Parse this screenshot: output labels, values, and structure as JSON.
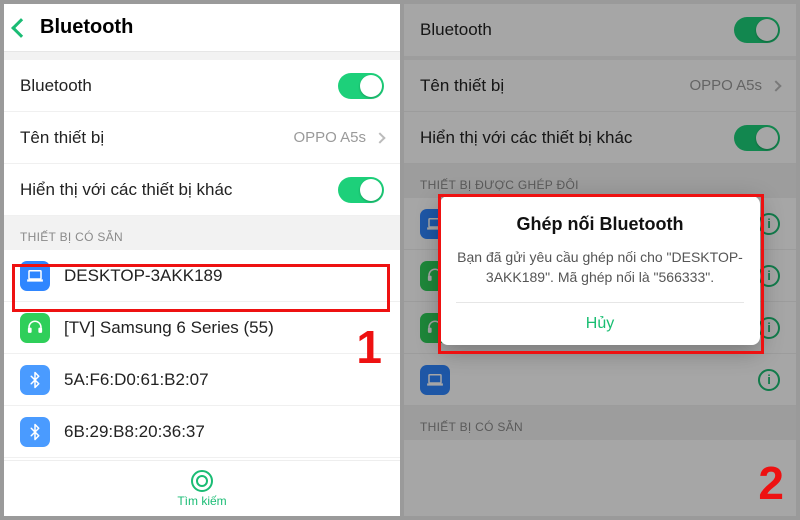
{
  "left": {
    "title": "Bluetooth",
    "rows": {
      "bluetooth": "Bluetooth",
      "device_name_label": "Tên thiết bị",
      "device_name_value": "OPPO A5s",
      "visibility": "Hiển thị với các thiết bị khác"
    },
    "section_available": "THIẾT BỊ CÓ SẴN",
    "devices": [
      {
        "name": "DESKTOP-3AKK189",
        "kind": "laptop"
      },
      {
        "name": "[TV] Samsung 6 Series (55)",
        "kind": "tv"
      },
      {
        "name": "5A:F6:D0:61:B2:07",
        "kind": "bt"
      },
      {
        "name": "6B:29:B8:20:36:37",
        "kind": "bt"
      }
    ],
    "footer": "Tìm kiếm",
    "step_num": "1"
  },
  "right": {
    "rows": {
      "bluetooth": "Bluetooth",
      "device_name_label": "Tên thiết bị",
      "device_name_value": "OPPO A5s",
      "visibility": "Hiển thị với các thiết bị khác"
    },
    "section_paired": "THIẾT BỊ ĐƯỢC GHÉP ĐÔI",
    "section_available": "THIẾT BỊ CÓ SẴN",
    "dialog": {
      "title": "Ghép nối Bluetooth",
      "body": "Bạn đã gửi yêu cầu ghép nối cho \"DESKTOP-3AKK189\". Mã ghép nối là \"566333\".",
      "cancel": "Hủy"
    },
    "step_num": "2"
  }
}
